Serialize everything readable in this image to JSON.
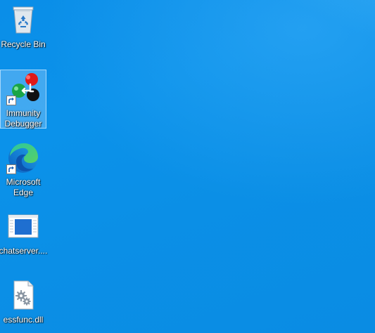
{
  "desktop": {
    "background_color": "#0b8fe6",
    "icons": [
      {
        "label": "Recycle Bin",
        "icon": "recycle-bin-icon",
        "shortcut": false,
        "selected": false
      },
      {
        "label": "Immunity\nDebugger",
        "icon": "immunity-debugger-icon",
        "shortcut": true,
        "selected": true
      },
      {
        "label": "Microsoft\nEdge",
        "icon": "microsoft-edge-icon",
        "shortcut": true,
        "selected": false
      },
      {
        "label": "chatserver....",
        "icon": "application-window-icon",
        "shortcut": false,
        "selected": false
      },
      {
        "label": "essfunc.dll",
        "icon": "dll-file-icon",
        "shortcut": false,
        "selected": false
      }
    ]
  }
}
